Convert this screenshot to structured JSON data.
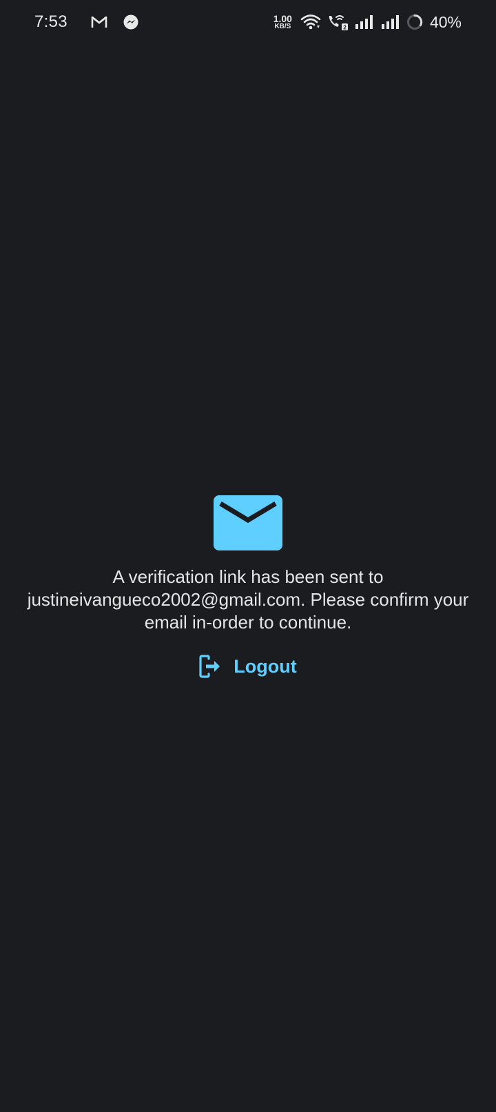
{
  "status_bar": {
    "time": "7:53",
    "notification_icons": [
      "gmail-icon",
      "messenger-icon"
    ],
    "net_speed_value": "1.00",
    "net_speed_unit": "KB/S",
    "battery_percent": "40%",
    "icons": [
      "wifi-icon",
      "wifi-calling-icon",
      "signal-1-icon",
      "signal-2-icon",
      "battery-ring-icon"
    ]
  },
  "verification": {
    "message": "A verification link has been sent to justineivangueco2002@gmail.com. Please confirm your email in-order to continue.",
    "logout_label": "Logout",
    "icon": "mail-icon",
    "logout_icon": "logout-icon"
  },
  "colors": {
    "background": "#1a1c1f",
    "accent": "#5fcfff",
    "text": "#e4e4e4"
  }
}
